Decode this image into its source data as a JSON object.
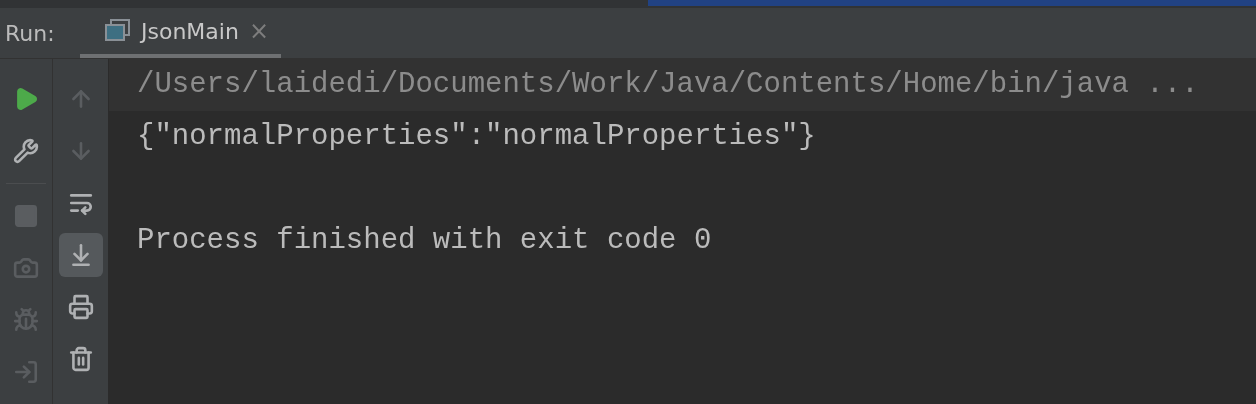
{
  "run_panel": {
    "label": "Run:",
    "tabs": [
      {
        "title": "JsonMain",
        "close": "×",
        "selected": true
      }
    ]
  },
  "left_toolbar": [
    {
      "kind": "run",
      "disabled": false
    },
    {
      "kind": "settings",
      "disabled": false
    },
    {
      "kind": "stop",
      "disabled": true
    },
    {
      "kind": "camera",
      "disabled": true
    },
    {
      "kind": "debug",
      "disabled": true
    },
    {
      "kind": "login",
      "disabled": true
    }
  ],
  "console_toolbar": [
    {
      "kind": "up",
      "disabled": true,
      "on": false
    },
    {
      "kind": "down",
      "disabled": true,
      "on": false
    },
    {
      "kind": "wrap",
      "disabled": false,
      "on": false
    },
    {
      "kind": "scroll_end",
      "disabled": false,
      "on": true
    },
    {
      "kind": "print",
      "disabled": false,
      "on": false
    },
    {
      "kind": "trash",
      "disabled": false,
      "on": false
    }
  ],
  "console": {
    "lines": [
      {
        "text": "/Users/laidedi/Documents/Work/Java/Contents/Home/bin/java ...",
        "kind": "command"
      },
      {
        "text": "{\"normalProperties\":\"normalProperties\"}",
        "kind": "output"
      },
      {
        "kind": "blank"
      },
      {
        "text": "Process finished with exit code 0",
        "kind": "output"
      }
    ]
  }
}
